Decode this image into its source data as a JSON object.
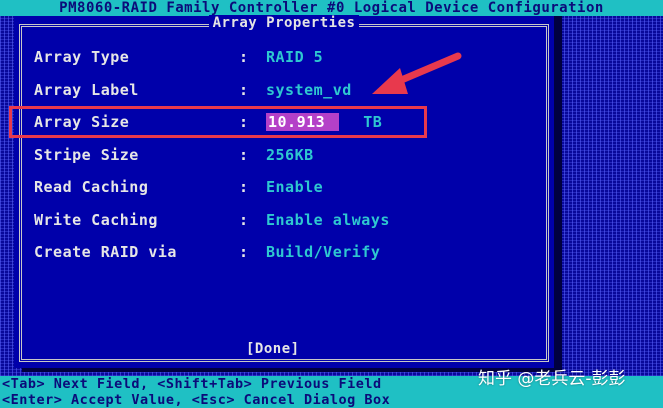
{
  "title_bar": "PM8060-RAID Family Controller #0 Logical Device Configuration",
  "dialog": {
    "title": "Array Properties",
    "rows": [
      {
        "label": "Array Type",
        "value": "RAID 5"
      },
      {
        "label": "Array Label",
        "value": "system_vd"
      },
      {
        "label": "Array Size",
        "value": "10.913",
        "unit": "TB"
      },
      {
        "label": "Stripe Size",
        "value": "256KB"
      },
      {
        "label": "Read Caching",
        "value": "Enable"
      },
      {
        "label": "Write Caching",
        "value": "Enable always"
      },
      {
        "label": "Create RAID via",
        "value": "Build/Verify"
      }
    ],
    "separator": ":",
    "done_label": "[Done]"
  },
  "status_bar": {
    "line1": "<Tab> Next Field, <Shift+Tab> Previous Field",
    "line2": "<Enter> Accept Value, <Esc> Cancel Dialog Box"
  },
  "annotation": {
    "highlight_color": "#e8394d",
    "arrow_icon": "red-arrow-icon"
  },
  "watermark": "知乎 @老兵云-彭彭",
  "colors": {
    "background": "#0000aa",
    "bars": "#1fc0c4",
    "value_text": "#2ec8d0",
    "selected_field": "#b440c8"
  }
}
